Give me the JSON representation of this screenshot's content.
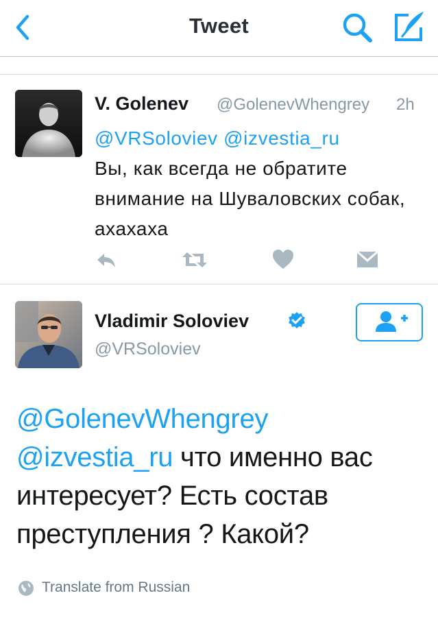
{
  "nav": {
    "title": "Tweet",
    "back_icon": "chevron-left-icon",
    "search_icon": "search-icon",
    "compose_icon": "compose-icon",
    "accent": "#1da1f2"
  },
  "reply_tweet": {
    "author_name": "V. Golenev",
    "author_handle": "@GolenevWhengrey",
    "time": "2h",
    "mention_1": "@VRSoloviev",
    "mention_2": "@izvestia_ru",
    "text": "Вы, как всегда не обратите внимание на Шуваловских собак, ахахаха",
    "actions": [
      "reply-icon",
      "retweet-icon",
      "heart-icon",
      "direct-message-icon"
    ]
  },
  "main_tweet": {
    "author_name": "Vladimir Soloviev",
    "author_handle": "@VRSoloviev",
    "verified": true,
    "follow_icon": "add-user-icon",
    "mention_1": "@GolenevWhengrey",
    "mention_2": "@izvestia_ru",
    "text": "что именно вас интересует? Есть состав преступления ? Какой?",
    "translate_label": "Translate from Russian",
    "translate_icon": "globe-icon"
  },
  "colors": {
    "link": "#1da1f2",
    "muted": "#8899a6",
    "action_icons": "#aab8c2",
    "text": "#14171a"
  }
}
